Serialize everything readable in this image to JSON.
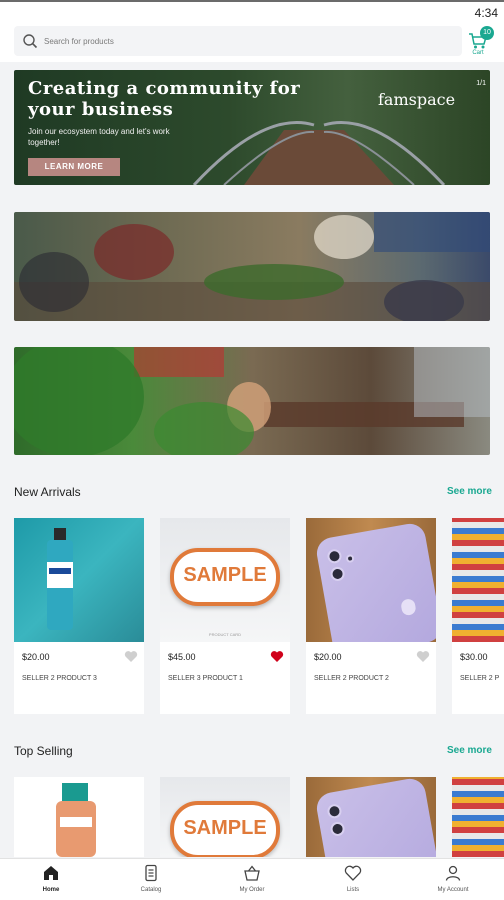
{
  "status_bar": {
    "time": "4:34"
  },
  "search": {
    "placeholder": "Search for products"
  },
  "cart": {
    "label": "Cart",
    "count": "10"
  },
  "banner": {
    "title": "Creating a community for your business",
    "subtitle": "Join our ecosystem today and let's work together!",
    "button": "LEARN MORE",
    "brand": "famspace",
    "index": "1/1"
  },
  "sections": {
    "new_arrivals": {
      "title": "New Arrivals",
      "see_more": "See more",
      "products": [
        {
          "price": "$20.00",
          "name": "SELLER 2 PRODUCT 3",
          "favorited": false,
          "image": "mouthwash-bottle"
        },
        {
          "price": "$45.00",
          "name": "SELLER 3 PRODUCT 1",
          "favorited": true,
          "image": "sample-tag"
        },
        {
          "price": "$20.00",
          "name": "SELLER 2 PRODUCT 2",
          "favorited": false,
          "image": "purple-phone"
        },
        {
          "price": "$30.00",
          "name": "SELLER 2 P",
          "favorited": false,
          "image": "store-shelf"
        }
      ],
      "sample_label": "SAMPLE",
      "sample_caption": "PRODUCT CARD"
    },
    "top_selling": {
      "title": "Top Selling",
      "see_more": "See more",
      "sample_label": "SAMPLE"
    }
  },
  "tabs": [
    {
      "label": "Home",
      "icon": "home-icon",
      "active": true
    },
    {
      "label": "Catalog",
      "icon": "catalog-icon",
      "active": false
    },
    {
      "label": "My Order",
      "icon": "basket-icon",
      "active": false
    },
    {
      "label": "Lists",
      "icon": "heart-icon",
      "active": false
    },
    {
      "label": "My Account",
      "icon": "user-icon",
      "active": false
    }
  ],
  "colors": {
    "accent": "#1aa891",
    "heart_active": "#d0021b",
    "heart_inactive": "#cfcfcf"
  }
}
